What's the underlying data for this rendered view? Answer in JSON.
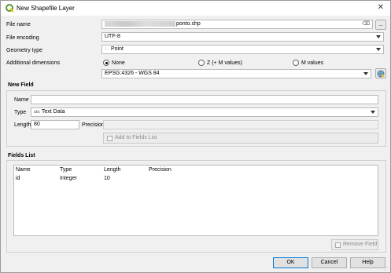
{
  "window": {
    "title": "New Shapefile Layer",
    "close_glyph": "✕"
  },
  "file_name": {
    "label": "File name",
    "value_suffix": "ponto.shp",
    "clear_glyph": "⌫",
    "browse_label": "..."
  },
  "file_encoding": {
    "label": "File encoding",
    "value": "UTF-8"
  },
  "geometry_type": {
    "label": "Geometry type",
    "value": "Point",
    "icon": "point-geometry-icon"
  },
  "additional_dimensions": {
    "label": "Additional dimensions",
    "options": [
      {
        "label": "None",
        "selected": true
      },
      {
        "label": "Z (+ M values)",
        "selected": false
      },
      {
        "label": "M values",
        "selected": false
      }
    ]
  },
  "crs": {
    "value": "EPSG:4326 - WGS 84",
    "icon": "globe-select-icon"
  },
  "new_field": {
    "heading": "New Field",
    "name_label": "Name",
    "name_value": "",
    "type_label": "Type",
    "type_icon_text": "abc",
    "type_value": "Text Data",
    "length_label": "Length",
    "length_value": "80",
    "precision_label": "Precision",
    "precision_value": "",
    "add_button": "Add to Fields List"
  },
  "fields_list": {
    "heading": "Fields List",
    "columns": [
      "Name",
      "Type",
      "Length",
      "Precision"
    ],
    "rows": [
      {
        "name": "id",
        "type": "Integer",
        "length": "10",
        "precision": ""
      }
    ],
    "remove_button": "Remove Field"
  },
  "buttons": {
    "ok": "OK",
    "cancel": "Cancel",
    "help": "Help"
  },
  "colors": {
    "accent": "#0078d7",
    "window_bg": "#f0f0f0",
    "qgis_green": "#589632"
  }
}
